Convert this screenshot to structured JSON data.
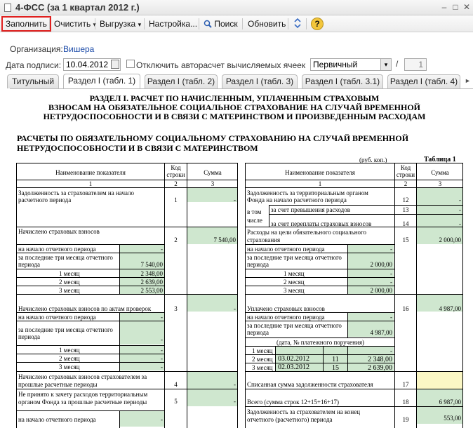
{
  "window": {
    "title": "4-ФСС (за 1 квартал 2012 г.)",
    "min": "–",
    "max": "□",
    "close": "✕"
  },
  "toolbar": {
    "fill": "Заполнить",
    "clear": "Очистить",
    "export": "Выгрузка",
    "settings": "Настройка...",
    "search": "Поиск",
    "refresh": "Обновить",
    "help": "?",
    "arrow": "▾"
  },
  "form": {
    "org_label": "Организация:",
    "org_value": "Вишера",
    "date_label": "Дата подписи:",
    "date_value": "10.04.2012",
    "autocalc_label": "Отключить авторасчет вычисляемых ячеек",
    "report_type": "Первичный",
    "slash": "/",
    "num": "1"
  },
  "tabs": [
    "Титульный",
    "Раздел I (табл. 1)",
    "Раздел I (табл. 2)",
    "Раздел I (табл. 3)",
    "Раздел I (табл. 3.1)",
    "Раздел I (табл. 4)"
  ],
  "doc": {
    "section_title": [
      "РАЗДЕЛ I.   РАСЧЕТ ПО НАЧИСЛЕННЫМ, УПЛАЧЕННЫМ СТРАХОВЫМ",
      "ВЗНОСАМ НА ОБЯЗАТЕЛЬНОЕ СОЦИАЛЬНОЕ СТРАХОВАНИЕ НА СЛУЧАЙ ВРЕМЕННОЙ",
      "НЕТРУДОСПОСОБНОСТИ И В СВЯЗИ С МАТЕРИНСТВОМ И ПРОИЗВЕДЕННЫМ РАСХОДАМ"
    ],
    "sub_title": [
      "РАСЧЕТЫ ПО ОБЯЗАТЕЛЬНОМУ СОЦИАЛЬНОМУ СТРАХОВАНИЮ НА СЛУЧАЙ ВРЕМЕННОЙ",
      "НЕТРУДОСПОСОБНОСТИ И В СВЯЗИ С МАТЕРИНСТВОМ"
    ],
    "units": "(руб. коп.)",
    "table_no": "Таблица 1",
    "hdr": {
      "name": "Наименование показателя",
      "code": "Код строки",
      "code2": "строки",
      "sum": "Сумма",
      "n1": "1",
      "n2": "2",
      "n3": "3"
    },
    "left": {
      "r1a": "Задолженность за страхователем на начало",
      "r1b": "расчетного периода",
      "r1code": "1",
      "r1val": "-",
      "r2": "Начислено страховых взносов",
      "r2code": "2",
      "r2val": "7 540,00",
      "r2s1": "на начало отчетного периода",
      "r2s1v": "-",
      "r2s2a": "за последние три месяца отчетного",
      "r2s2b": "периода",
      "r2s2v": "7 540,00",
      "m1": "1 месяц",
      "m1v": "2 348,00",
      "m2": "2 месяц",
      "m2v": "2 639,00",
      "m3": "3 месяц",
      "m3v": "2 553,00",
      "r3": "Начислено страховых взносов по актам проверок",
      "r3code": "3",
      "r3val": "-",
      "r3s1": "на начало отчетного периода",
      "r3s1v": "-",
      "r3s2a": "за последние три месяца отчетного",
      "r3s2b": "периода",
      "r3s2v": "-",
      "r3m1": "1 месяц",
      "r3m1v": "-",
      "r3m2": "2 месяц",
      "r3m2v": "-",
      "r3m3": "3 месяц",
      "r3m3v": "-",
      "r4a": "Начислено страховых взносов страхователем за",
      "r4b": "прошлые расчетные периоды",
      "r4code": "4",
      "r4val": "-",
      "r5a": "Не принято к зачету расходов территориальным",
      "r5b": "органом Фонда за прошлые расчетные периоды",
      "r5code": "5",
      "r5val": "-",
      "r5s1": "на начало отчетного периода",
      "r5s1v": "-"
    },
    "right": {
      "r12a": "Задолженность за территориальным органом",
      "r12b": "Фонда на  начало расчетного периода",
      "r12code": "12",
      "r12val": "-",
      "intotal": "в том",
      "intotal2": "числе",
      "r13": "за счет превышения расходов",
      "r13code": "13",
      "r13val": "-",
      "r14": "за счет переплаты страховых взносов",
      "r14code": "14",
      "r14val": "-",
      "r15a": "Расходы на цели обязательного социального",
      "r15b": "страхования",
      "r15code": "15",
      "r15val": "2 000,00",
      "r15s1": "на начало отчетного периода",
      "r15s1v": "-",
      "r15s2a": "за последние три месяца отчетного",
      "r15s2b": "периода",
      "r15s2v": "2 000,00",
      "m1": "1 месяц",
      "m1v": "-",
      "m2": "2 месяц",
      "m2v": "-",
      "m3": "3 месяц",
      "m3v": "2 000,00",
      "r16": "Уплачено страховых взносов",
      "r16code": "16",
      "r16val": "4 987,00",
      "r16s1": "на начало отчетного периода",
      "r16s1v": "-",
      "r16s2a": "за последние три месяца отчетного",
      "r16s2b": "периода",
      "r16s2v": "4 987,00",
      "pay": "(дата, № платежного поручения)",
      "p1": "1 месяц",
      "p1v": "-",
      "p2": "2 месяц",
      "p2d": "03.02.2012",
      "p2n": "11",
      "p2v": "2 348,00",
      "p3": "3 месяц",
      "p3d": "02.03.2012",
      "p3n": "15",
      "p3v": "2 639,00",
      "r17": "Списанная сумма задолженности страхователя",
      "r17code": "17",
      "r17val": "",
      "r18": "Всего (сумма строк 12+15+16+17)",
      "r18code": "18",
      "r18val": "6 987,00",
      "r19a": "Задолженность за страхователем на конец",
      "r19b": "отчетного (расчетного) периода",
      "r19code": "19",
      "r19val": "553,00"
    }
  }
}
